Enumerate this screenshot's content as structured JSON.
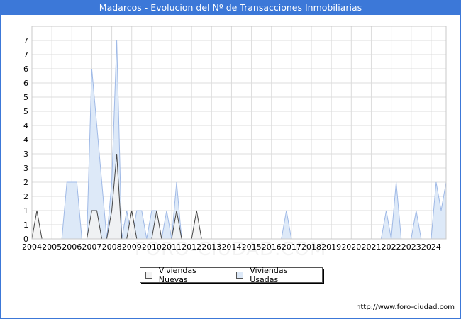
{
  "title": "Madarcos - Evolucion del Nº de Transacciones Inmobiliarias",
  "watermark": "FORO-CIUDAD.COM",
  "footer_url": "http://www.foro-ciudad.com",
  "legend": [
    {
      "label": "Viviendas Nuevas",
      "color": "#f2f2f2"
    },
    {
      "label": "Viviendas Usadas",
      "color": "#dde9f8"
    }
  ],
  "chart_data": {
    "type": "area",
    "title": "Madarcos - Evolucion del Nº de Transacciones Inmobiliarias",
    "xlabel": "",
    "ylabel": "",
    "x_tick_labels": [
      "2004",
      "2005",
      "2006",
      "2007",
      "2008",
      "2009",
      "2010",
      "2011",
      "2012",
      "2013",
      "2014",
      "2015",
      "2016",
      "2017",
      "2018",
      "2019",
      "2020",
      "2021",
      "2022",
      "2023",
      "2024"
    ],
    "y_tick_labels": [
      "0",
      "1",
      "1",
      "2",
      "2",
      "3",
      "3",
      "4",
      "4",
      "5",
      "5",
      "6",
      "6",
      "7",
      "7"
    ],
    "ylim": [
      0,
      7.5
    ],
    "xlim": [
      2004,
      2024.75
    ],
    "grid": true,
    "legend_position": "bottom-center",
    "series": [
      {
        "name": "Viviendas Nuevas",
        "color": "#f2f2f2",
        "stroke": "#444444",
        "points": [
          [
            2004,
            0
          ],
          [
            2004.25,
            1
          ],
          [
            2004.5,
            0
          ],
          [
            2006.75,
            0
          ],
          [
            2007,
            1
          ],
          [
            2007.25,
            1
          ],
          [
            2007.5,
            0
          ],
          [
            2007.75,
            0
          ],
          [
            2008,
            1
          ],
          [
            2008.25,
            3
          ],
          [
            2008.5,
            0
          ],
          [
            2008.75,
            0
          ],
          [
            2009,
            1
          ],
          [
            2009.25,
            0
          ],
          [
            2010,
            0
          ],
          [
            2010.25,
            1
          ],
          [
            2010.5,
            0
          ],
          [
            2011,
            0
          ],
          [
            2011.25,
            1
          ],
          [
            2011.5,
            0
          ],
          [
            2012,
            0
          ],
          [
            2012.25,
            1
          ],
          [
            2012.5,
            0
          ],
          [
            2024.75,
            0
          ]
        ]
      },
      {
        "name": "Viviendas Usadas",
        "color": "#dde9f8",
        "stroke": "#9fb9e6",
        "points": [
          [
            2004,
            0
          ],
          [
            2005.5,
            0
          ],
          [
            2005.75,
            2
          ],
          [
            2006.25,
            2
          ],
          [
            2006.5,
            0
          ],
          [
            2006.75,
            0
          ],
          [
            2007,
            6
          ],
          [
            2007.25,
            4
          ],
          [
            2007.5,
            2
          ],
          [
            2007.75,
            0
          ],
          [
            2008,
            2
          ],
          [
            2008.25,
            7
          ],
          [
            2008.5,
            0
          ],
          [
            2008.75,
            1
          ],
          [
            2009,
            0
          ],
          [
            2009.25,
            1
          ],
          [
            2009.5,
            1
          ],
          [
            2009.75,
            0
          ],
          [
            2010,
            1
          ],
          [
            2010.25,
            1
          ],
          [
            2010.5,
            0
          ],
          [
            2010.75,
            1
          ],
          [
            2011,
            0
          ],
          [
            2011.25,
            2
          ],
          [
            2011.5,
            0
          ],
          [
            2016.5,
            0
          ],
          [
            2016.75,
            1
          ],
          [
            2017,
            0
          ],
          [
            2021.5,
            0
          ],
          [
            2021.75,
            1
          ],
          [
            2022,
            0
          ],
          [
            2022.25,
            2
          ],
          [
            2022.5,
            0
          ],
          [
            2023,
            0
          ],
          [
            2023.25,
            1
          ],
          [
            2023.5,
            0
          ],
          [
            2024,
            0
          ],
          [
            2024.25,
            2
          ],
          [
            2024.5,
            1
          ],
          [
            2024.75,
            2
          ]
        ]
      }
    ]
  }
}
